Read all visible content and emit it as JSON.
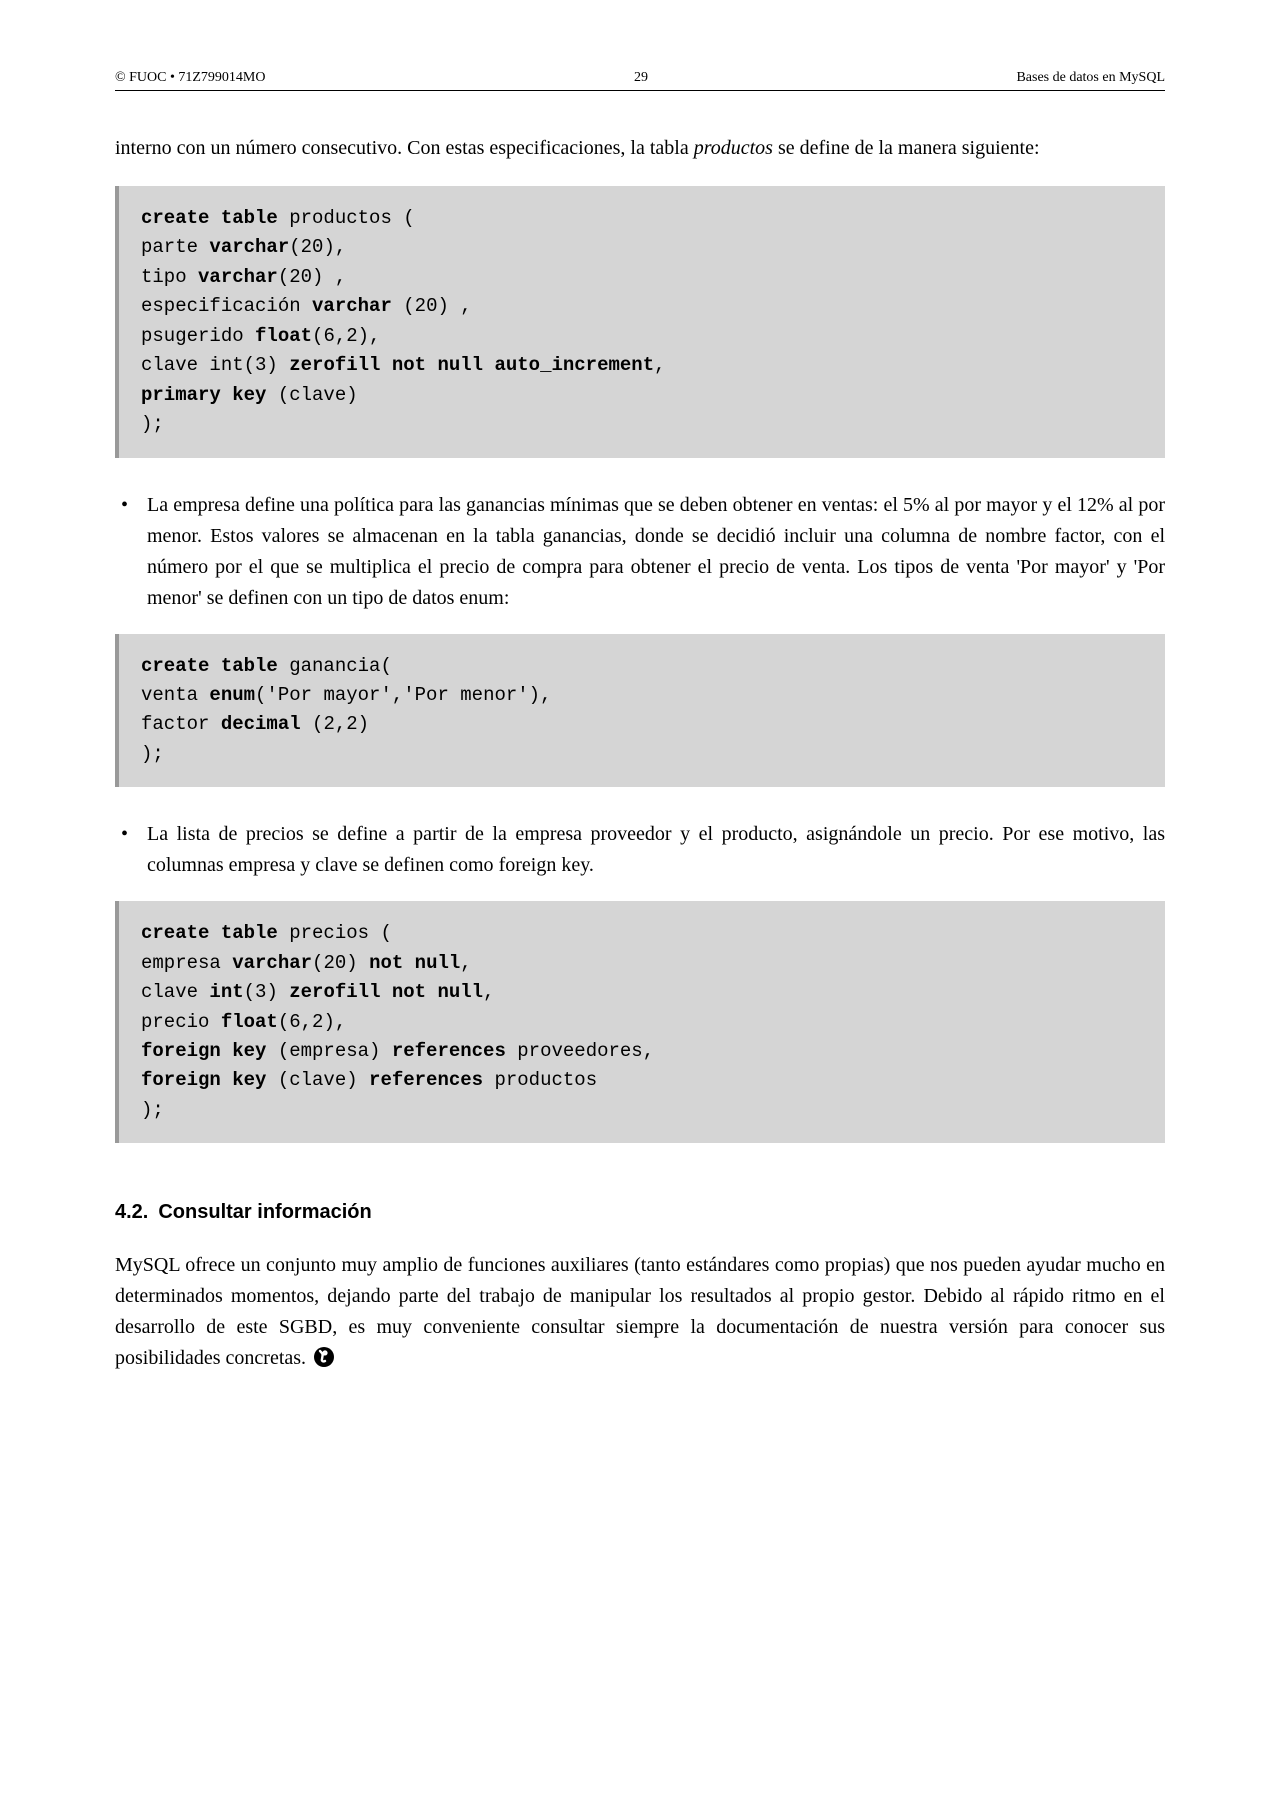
{
  "header": {
    "left": "© FUOC • 71Z799014MO",
    "center": "29",
    "right": "Bases de datos en MySQL"
  },
  "intro": {
    "pre": "interno con un número consecutivo. Con estas especificaciones, la tabla ",
    "italic": "productos",
    "post": " se define de la manera siguiente:"
  },
  "code1": {
    "l1a": "create table",
    "l1b": " productos (",
    "l2a": "parte ",
    "l2b": "varchar",
    "l2c": "(20),",
    "l3a": "tipo ",
    "l3b": "varchar",
    "l3c": "(20) ,",
    "l4a": "especificación ",
    "l4b": "varchar",
    "l4c": " (20) ,",
    "l5a": "psugerido ",
    "l5b": "float",
    "l5c": "(6,2),",
    "l6a": "clave int(3) ",
    "l6b": "zerofill not null auto_increment",
    "l6c": ",",
    "l7a": "primary key",
    "l7b": " (clave)",
    "l8": ");"
  },
  "bullet1": {
    "t1": "La empresa define una política para las ganancias mínimas que se deben obtener en ventas: el 5% al por mayor y el 12% al por menor. Estos valores se almacenan en la tabla ",
    "i1": "ganancias",
    "t2": ", donde se decidió incluir una columna de nombre ",
    "i2": "factor",
    "t3": ", con el número por el que se multiplica el precio de compra para obtener el precio de venta. Los tipos de venta '",
    "i3": "Por mayor",
    "t4": "' y '",
    "i4": "Por menor",
    "t5": "' se definen con un tipo de datos ",
    "b1": "enum",
    "t6": ":"
  },
  "code2": {
    "l1a": "create table",
    "l1b": " ganancia(",
    "l2a": "venta ",
    "l2b": "enum",
    "l2c": "('Por mayor','Por menor'),",
    "l3a": "factor ",
    "l3b": "decimal",
    "l3c": " (2,2)",
    "l4": ");"
  },
  "bullet2": {
    "t1": "La lista de precios se define a partir de la empresa proveedor y el producto, asignándole un precio. Por ese motivo, las columnas ",
    "i1": "empresa",
    "t2": " y ",
    "i2": "clave",
    "t3": " se definen como ",
    "b1": "foreign key",
    "t4": "."
  },
  "code3": {
    "l1a": "create table",
    "l1b": " precios (",
    "l2a": "empresa ",
    "l2b": "varchar",
    "l2c": "(20) ",
    "l2d": "not null",
    "l2e": ",",
    "l3a": "clave ",
    "l3b": "int",
    "l3c": "(3) ",
    "l3d": "zerofill not null",
    "l3e": ",",
    "l4a": "precio ",
    "l4b": "float",
    "l4c": "(6,2),",
    "l5a": "foreign key",
    "l5b": " (empresa) ",
    "l5c": "references",
    "l5d": " proveedores,",
    "l6a": "foreign key",
    "l6b": " (clave) ",
    "l6c": "references",
    "l6d": " productos",
    "l7": ");"
  },
  "section": {
    "num": "4.2.",
    "title": "Consultar información"
  },
  "closing": {
    "text": "MySQL ofrece un conjunto muy amplio de funciones auxiliares (tanto estándares como propias) que nos pueden ayudar mucho en determinados momentos, dejando parte del trabajo de manipular los resultados al propio gestor. Debido al rápido ritmo en el desarrollo de este SGBD, es muy conveniente consultar siempre la documentación de nuestra versión para conocer sus posibilidades concretas."
  }
}
